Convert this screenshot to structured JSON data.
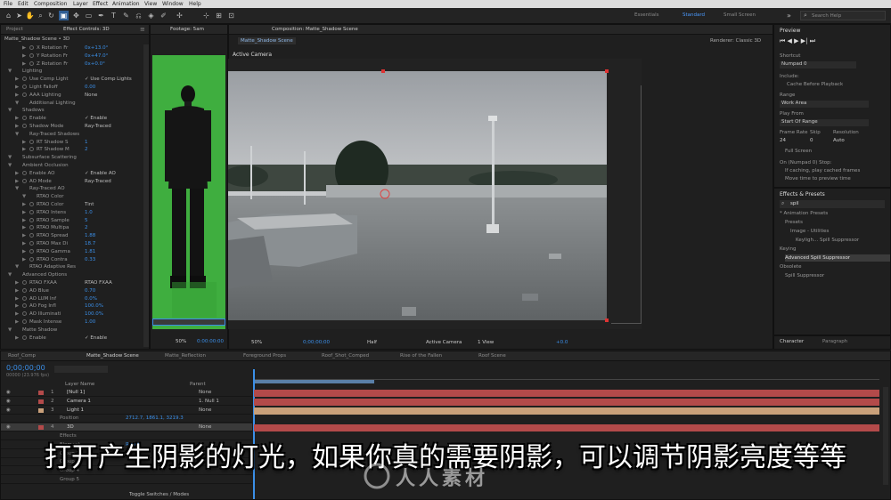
{
  "menu": [
    "File",
    "Edit",
    "Composition",
    "Layer",
    "Effect",
    "Animation",
    "View",
    "Window",
    "Help"
  ],
  "workspaces": {
    "items": [
      "Essentials",
      "Standard",
      "Small Screen"
    ],
    "active": "Standard"
  },
  "search_help_placeholder": "Search Help",
  "project_panel": {
    "tab": "Project",
    "title": "Matte_Shadow Scene • 3D"
  },
  "effect_controls": {
    "tab": "Effect Controls: 3D",
    "rows": [
      {
        "label": "X Rotation Fr",
        "value": "0x+13.0°",
        "indent": 3
      },
      {
        "label": "Y Rotation Fr",
        "value": "0x+47.0°",
        "indent": 3
      },
      {
        "label": "Z Rotation Fr",
        "value": "0x+0.0°",
        "indent": 3
      },
      {
        "label": "Lighting",
        "value": "",
        "indent": 1
      },
      {
        "label": "Use Comp Light",
        "value": "✓ Use Comp Lights",
        "indent": 2,
        "white": true
      },
      {
        "label": "Light Falloff",
        "value": "0.00",
        "indent": 2
      },
      {
        "label": "AAA Lighting",
        "value": "None",
        "indent": 2,
        "white": true
      },
      {
        "label": "Additional Lighting",
        "value": "",
        "indent": 2
      },
      {
        "label": "Shadows",
        "value": "",
        "indent": 1
      },
      {
        "label": "Enable",
        "value": "✓ Enable",
        "indent": 2,
        "white": true
      },
      {
        "label": "Shadow Mode",
        "value": "Ray-Traced",
        "indent": 2,
        "white": true
      },
      {
        "label": "Ray-Traced Shadows",
        "value": "",
        "indent": 2
      },
      {
        "label": "RT Shadow S",
        "value": "1",
        "indent": 3
      },
      {
        "label": "RT Shadow M",
        "value": "2",
        "indent": 3
      },
      {
        "label": "Subsurface Scattering",
        "value": "",
        "indent": 1
      },
      {
        "label": "Ambient Occlusion",
        "value": "",
        "indent": 1
      },
      {
        "label": "Enable AO",
        "value": "✓ Enable AO",
        "indent": 2,
        "white": true
      },
      {
        "label": "AO Mode",
        "value": "Ray-Traced",
        "indent": 2,
        "white": true
      },
      {
        "label": "Ray-Traced AO",
        "value": "",
        "indent": 2
      },
      {
        "label": "RTAO Color",
        "value": "",
        "indent": 3
      },
      {
        "label": "RTAO Color",
        "value": "Tint",
        "indent": 3,
        "white": true
      },
      {
        "label": "RTAO Intens",
        "value": "1.0",
        "indent": 3
      },
      {
        "label": "RTAO Sample",
        "value": "5",
        "indent": 3
      },
      {
        "label": "RTAO Multipa",
        "value": "2",
        "indent": 3
      },
      {
        "label": "RTAO Spread",
        "value": "1.88",
        "indent": 3
      },
      {
        "label": "RTAO Max Di",
        "value": "18.7",
        "indent": 3
      },
      {
        "label": "RTAO Gamma",
        "value": "1.81",
        "indent": 3
      },
      {
        "label": "RTAO Contra",
        "value": "0.33",
        "indent": 3
      },
      {
        "label": "RTAO Adaptive Res",
        "value": "",
        "indent": 2
      },
      {
        "label": "Advanced Options",
        "value": "",
        "indent": 1
      },
      {
        "label": "RTAO FXAA",
        "value": "RTAO FXAA",
        "indent": 2,
        "white": true
      },
      {
        "label": "AO Blue",
        "value": "0.70",
        "indent": 2
      },
      {
        "label": "AO LUM Inf",
        "value": "0.0%",
        "indent": 2
      },
      {
        "label": "AO Fog Infl",
        "value": "100.0%",
        "indent": 2
      },
      {
        "label": "AO Illuminati",
        "value": "100.0%",
        "indent": 2
      },
      {
        "label": "Mask Intense",
        "value": "1.00",
        "indent": 2
      },
      {
        "label": "Matte Shadow",
        "value": "",
        "indent": 1
      },
      {
        "label": "Enable",
        "value": "✓ Enable",
        "indent": 2,
        "white": true
      }
    ]
  },
  "footage_panel": {
    "tab": "Footage: 5am",
    "zoom": "50%",
    "time": "0:00:00:00"
  },
  "composition_panel": {
    "tab": "Composition: Matte_Shadow Scene",
    "subtab": "Matte_Shadow Scene",
    "view_label": "Active Camera",
    "renderer": "Renderer:  Classic 3D",
    "zoom": "50%",
    "time": "0;00;00;00",
    "resolution": "Half",
    "camera": "Active Camera",
    "views": "1 View",
    "offset": "+0.0"
  },
  "preview_panel": {
    "title": "Preview",
    "shortcut_label": "Shortcut",
    "shortcut_value": "Numpad 0",
    "include_label": "Include:",
    "cache_label": "Cache Before Playback",
    "range_label": "Range",
    "range_value": "Work Area",
    "play_from_label": "Play From",
    "play_from_value": "Start Of Range",
    "frame_rate_label": "Frame Rate",
    "skip_label": "Skip",
    "resolution_label": "Resolution",
    "frame_rate_value": "24",
    "skip_value": "0",
    "resolution_value": "Auto",
    "full_screen": "Full Screen",
    "on_stop_label": "On (Numpad 0) Stop:",
    "if_caching": "If caching, play cached frames",
    "move_time": "Move time to preview time"
  },
  "effects_panel": {
    "title": "Effects & Presets",
    "search": "spil",
    "items": [
      {
        "label": "* Animation Presets",
        "indent": 0
      },
      {
        "label": "Presets",
        "indent": 1
      },
      {
        "label": "Image - Utilities",
        "indent": 2
      },
      {
        "label": "Keyligh... Spill Suppressor",
        "indent": 3
      },
      {
        "label": "Keying",
        "indent": 0
      },
      {
        "label": "Advanced Spill Suppressor",
        "indent": 1,
        "selected": true
      },
      {
        "label": "Obsolete",
        "indent": 0
      },
      {
        "label": "Spill Suppressor",
        "indent": 1
      }
    ]
  },
  "character_panel": {
    "tabs": [
      "Character",
      "Paragraph"
    ]
  },
  "timeline": {
    "tabs": [
      "Roof_Comp",
      "Matte_Shadow Scene",
      "Matte_Reflection",
      "Foreground Props",
      "Roof_Shot_Comped",
      "Rise of the Fallen",
      "Roof Scene"
    ],
    "active_tab": "Matte_Shadow Scene",
    "time": "0;00;00;00",
    "fps": "00000 (23.976 fps)",
    "col_layer_name": "Layer Name",
    "col_parent": "Parent",
    "layers": [
      {
        "num": "1",
        "name": "[Null 1]",
        "parent": "None",
        "color": "#b34a4a"
      },
      {
        "num": "2",
        "name": "Camera 1",
        "parent": "1. Null 1",
        "color": "#b34a4a"
      },
      {
        "num": "3",
        "name": "Light 1",
        "parent": "None",
        "color": "#c9a07a"
      },
      {
        "num": "",
        "name": "Position",
        "parent": "",
        "sub": true,
        "value": "2712.7, 1861.1, 3219.3"
      },
      {
        "num": "4",
        "name": "3D",
        "parent": "None",
        "color": "#b34a4a",
        "selected": true
      },
      {
        "num": "",
        "name": "Effects",
        "parent": "",
        "sub": true
      },
      {
        "num": "",
        "name": "Element",
        "parent": "",
        "sub": true,
        "value": "Reset"
      },
      {
        "num": "",
        "name": "Group 1",
        "parent": "",
        "sub": true
      },
      {
        "num": "",
        "name": "Group 2",
        "parent": "",
        "sub": true
      },
      {
        "num": "",
        "name": "Group 4",
        "parent": "",
        "sub": true
      },
      {
        "num": "",
        "name": "Group 5",
        "parent": "",
        "sub": true
      }
    ],
    "toggle_label": "Toggle Switches / Modes"
  },
  "subtitle": "打开产生阴影的灯光，如果你真的需要阴影，可以调节阴影亮度等等",
  "watermark": "人人素材",
  "colors": {
    "accent": "#3b8fe8",
    "layer_red": "#b34a4a",
    "layer_tan": "#c9a07a",
    "green_screen": "#3fae3f"
  }
}
